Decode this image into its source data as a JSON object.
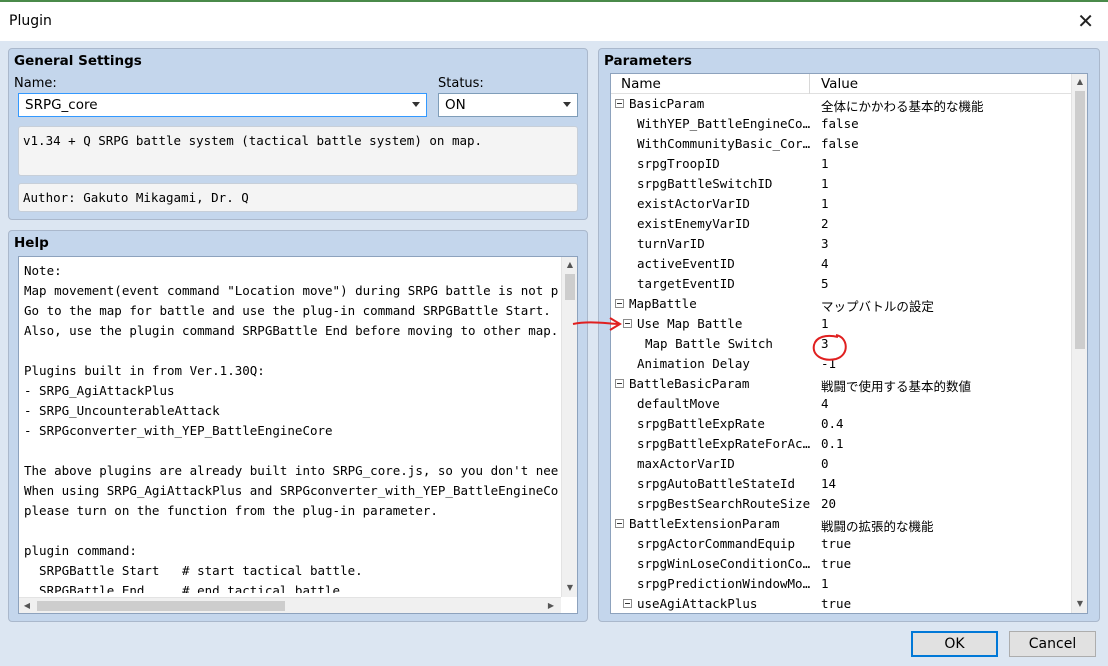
{
  "window": {
    "title": "Plugin",
    "close_glyph": "✕"
  },
  "general": {
    "title": "General Settings",
    "name_label": "Name:",
    "name_value": "SRPG_core",
    "status_label": "Status:",
    "status_value": "ON",
    "description": "v1.34 + Q SRPG battle system (tactical battle system) on map.",
    "author": "Author: Gakuto Mikagami, Dr. Q"
  },
  "help": {
    "title": "Help",
    "lines": [
      "Note:",
      "Map movement(event command \"Location move\") during SRPG battle is not possible.",
      "Go to the map for battle and use the plug-in command SRPGBattle Start.",
      "Also, use the plugin command SRPGBattle End before moving to other map.",
      "",
      "Plugins built in from Ver.1.30Q:",
      "- SRPG_AgiAttackPlus",
      "- SRPG_UncounterableAttack",
      "- SRPGconverter_with_YEP_BattleEngineCore",
      "",
      "The above plugins are already built into SRPG_core.js, so you don't need to install them.",
      "When using SRPG_AgiAttackPlus and SRPGconverter_with_YEP_BattleEngineCore,",
      "please turn on the function from the plug-in parameter.",
      "",
      "plugin command:",
      "  SRPGBattle Start   # start tactical battle.",
      "  SRPGBattle End     # end tactical battle."
    ]
  },
  "parameters": {
    "title": "Parameters",
    "col_name": "Name",
    "col_value": "Value",
    "rows": [
      {
        "name": "BasicParam",
        "value": "全体にかかわる基本的な機能",
        "level": 0,
        "expander": true
      },
      {
        "name": "WithYEP_BattleEngineCore",
        "value": "false",
        "level": 1
      },
      {
        "name": "WithCommunityBasic_Core…",
        "value": "false",
        "level": 1
      },
      {
        "name": "srpgTroopID",
        "value": "1",
        "level": 1
      },
      {
        "name": "srpgBattleSwitchID",
        "value": "1",
        "level": 1
      },
      {
        "name": "existActorVarID",
        "value": "1",
        "level": 1
      },
      {
        "name": "existEnemyVarID",
        "value": "2",
        "level": 1
      },
      {
        "name": "turnVarID",
        "value": "3",
        "level": 1
      },
      {
        "name": "activeEventID",
        "value": "4",
        "level": 1
      },
      {
        "name": "targetEventID",
        "value": "5",
        "level": 1
      },
      {
        "name": "MapBattle",
        "value": "マップバトルの設定",
        "level": 0,
        "expander": true
      },
      {
        "name": "Use Map Battle",
        "value": "1",
        "level": 1,
        "expander": true
      },
      {
        "name": "Map Battle Switch",
        "value": "3",
        "level": 2
      },
      {
        "name": "Animation Delay",
        "value": "-1",
        "level": 1
      },
      {
        "name": "BattleBasicParam",
        "value": "戦闘で使用する基本的数値",
        "level": 0,
        "expander": true
      },
      {
        "name": "defaultMove",
        "value": "4",
        "level": 1
      },
      {
        "name": "srpgBattleExpRate",
        "value": "0.4",
        "level": 1
      },
      {
        "name": "srpgBattleExpRateForAct…",
        "value": "0.1",
        "level": 1
      },
      {
        "name": "maxActorVarID",
        "value": "0",
        "level": 1
      },
      {
        "name": "srpgAutoBattleStateId",
        "value": "14",
        "level": 1
      },
      {
        "name": "srpgBestSearchRouteSize",
        "value": "20",
        "level": 1
      },
      {
        "name": "BattleExtensionParam",
        "value": "戦闘の拡張的な機能",
        "level": 0,
        "expander": true
      },
      {
        "name": "srpgActorCommandEquip",
        "value": "true",
        "level": 1
      },
      {
        "name": "srpgWinLoseConditionCom…",
        "value": "true",
        "level": 1
      },
      {
        "name": "srpgPredictionWindowMode",
        "value": "1",
        "level": 1
      },
      {
        "name": "useAgiAttackPlus",
        "value": "true",
        "level": 1,
        "expander": true
      }
    ]
  },
  "buttons": {
    "ok": "OK",
    "cancel": "Cancel"
  },
  "annotation": {
    "color": "#e02020"
  }
}
